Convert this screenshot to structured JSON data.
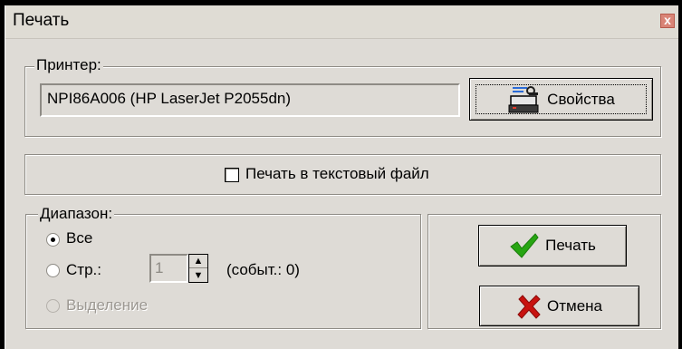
{
  "window": {
    "title": "Печать",
    "close_glyph": "x"
  },
  "printer_group": {
    "legend": "Принтер:",
    "printer_name": "NPI86A006 (HP LaserJet P2055dn)",
    "properties_label": "Свойства"
  },
  "print_to_file": {
    "label": "Печать в текстовый файл",
    "checked": false
  },
  "range_group": {
    "legend": "Диапазон:",
    "all_label": "Все",
    "pages_label": "Стр.:",
    "pages_value": "1",
    "events_label": "(событ.: 0)",
    "selection_label": "Выделение",
    "selected": "all"
  },
  "actions": {
    "print_label": "Печать",
    "cancel_label": "Отмена"
  },
  "colors": {
    "face": "#dedbd6",
    "check_green": "#27a512",
    "cancel_red": "#c8120f"
  }
}
